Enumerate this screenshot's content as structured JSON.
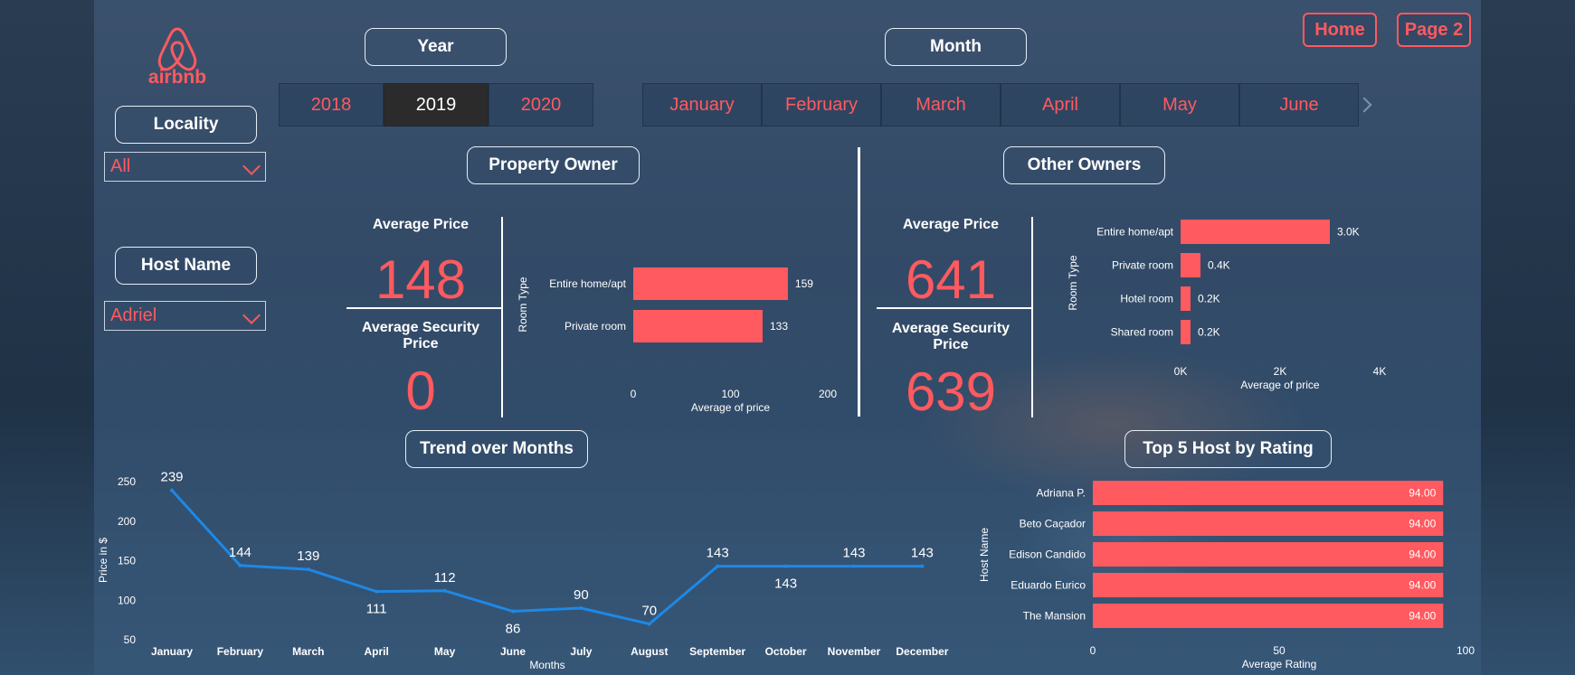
{
  "brand": {
    "name": "airbnb",
    "color": "#ff5a5f"
  },
  "nav": {
    "home": "Home",
    "page2": "Page 2"
  },
  "filters": {
    "year_label": "Year",
    "years": [
      "2018",
      "2019",
      "2020"
    ],
    "selected_year": "2019",
    "month_label": "Month",
    "months": [
      "January",
      "February",
      "March",
      "April",
      "May",
      "June"
    ],
    "locality_label": "Locality",
    "locality_value": "All",
    "host_label": "Host Name",
    "host_value": "Adriel"
  },
  "property_owner": {
    "title": "Property Owner",
    "avg_price_label": "Average Price",
    "avg_price": "148",
    "avg_security_label": "Average Security Price",
    "avg_security": "0"
  },
  "other_owners": {
    "title": "Other Owners",
    "avg_price_label": "Average Price",
    "avg_price": "641",
    "avg_security_label": "Average Security Price",
    "avg_security": "639"
  },
  "trend_title": "Trend over Months",
  "top_hosts_title": "Top 5 Host by Rating",
  "chart_data": [
    {
      "id": "property-owner-room-type",
      "type": "bar",
      "orientation": "horizontal",
      "categories": [
        "Entire home/apt",
        "Private room"
      ],
      "values": [
        159,
        133
      ],
      "value_labels": [
        "159",
        "133"
      ],
      "xlabel": "Average of price",
      "ylabel": "Room Type",
      "xlim": [
        0,
        200
      ],
      "xticks": [
        "0",
        "100",
        "200"
      ],
      "color": "#ff5a5f"
    },
    {
      "id": "other-owners-room-type",
      "type": "bar",
      "orientation": "horizontal",
      "categories": [
        "Entire home/apt",
        "Private room",
        "Hotel room",
        "Shared room"
      ],
      "values": [
        3000,
        400,
        200,
        200
      ],
      "value_labels": [
        "3.0K",
        "0.4K",
        "0.2K",
        "0.2K"
      ],
      "xlabel": "Average of price",
      "ylabel": "Room Type",
      "xlim": [
        0,
        4000
      ],
      "xticks": [
        "0K",
        "2K",
        "4K"
      ],
      "color": "#ff5a5f"
    },
    {
      "id": "trend-over-months",
      "type": "line",
      "categories": [
        "January",
        "February",
        "March",
        "April",
        "May",
        "June",
        "July",
        "August",
        "September",
        "October",
        "November",
        "December"
      ],
      "values": [
        239,
        144,
        139,
        111,
        112,
        86,
        90,
        70,
        143,
        143,
        143,
        143
      ],
      "value_labels": [
        "239",
        "144",
        "139",
        "111",
        "112",
        "86",
        "90",
        "70",
        "143",
        "143",
        "143",
        "143"
      ],
      "xlabel": "Months",
      "ylabel": "Price in $",
      "ylim": [
        50,
        250
      ],
      "yticks": [
        "50",
        "100",
        "150",
        "200",
        "250"
      ],
      "color": "#1e88e5"
    },
    {
      "id": "top-5-host-by-rating",
      "type": "bar",
      "orientation": "horizontal",
      "categories": [
        "Adriana P.",
        "Beto Caçador",
        "Edison Candido",
        "Eduardo Eurico",
        "The Mansion"
      ],
      "values": [
        94,
        94,
        94,
        94,
        94
      ],
      "value_labels": [
        "94.00",
        "94.00",
        "94.00",
        "94.00",
        "94.00"
      ],
      "xlabel": "Average Rating",
      "ylabel": "Host Name",
      "xlim": [
        0,
        100
      ],
      "xticks": [
        "0",
        "50",
        "100"
      ],
      "color": "#ff5a5f"
    }
  ]
}
